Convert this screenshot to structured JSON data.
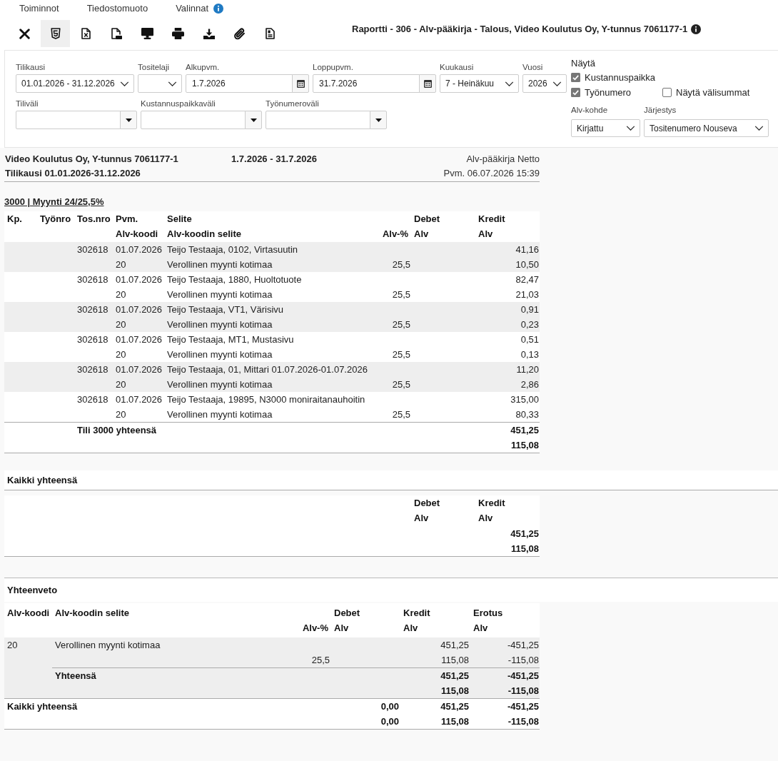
{
  "menu": [
    {
      "label": "Toiminnot",
      "info": false
    },
    {
      "label": "Tiedostomuoto",
      "info": false
    },
    {
      "label": "Valinnat",
      "info": true
    }
  ],
  "toolbar": [
    {
      "kind": "close",
      "selected": false
    },
    {
      "kind": "html",
      "selected": true
    },
    {
      "kind": "excel",
      "selected": false
    },
    {
      "kind": "pdf",
      "selected": false
    },
    {
      "kind": "screen",
      "selected": false
    },
    {
      "kind": "print",
      "selected": false
    },
    {
      "kind": "download",
      "selected": false
    },
    {
      "kind": "attachment",
      "selected": false
    },
    {
      "kind": "document",
      "selected": false
    }
  ],
  "report_title": "Raportti - 306 - Alv-pääkirja - Talous, Video Koulutus Oy, Y-tunnus 7061177-1",
  "filters": {
    "lines": [
      {
        "fields": [
          {
            "kind": "select",
            "label": "Tilikausi",
            "value": "01.01.2026 - 31.12.2026"
          },
          {
            "kind": "select",
            "label": "Tositelaji"
          },
          {
            "kind": "date",
            "label": "Alkupvm.",
            "value": "1.7.2026"
          },
          {
            "kind": "date",
            "label": "Loppupvm.",
            "value": "31.7.2026"
          },
          {
            "kind": "select",
            "label": "Kuukausi",
            "value": "7 - Heinäkuu"
          },
          {
            "kind": "select",
            "label": "Vuosi",
            "value": "2026"
          }
        ]
      },
      {
        "fields": [
          {
            "kind": "combo",
            "label": "Tiliväli"
          },
          {
            "kind": "combo",
            "label": "Kustannuspaikkaväli"
          },
          {
            "kind": "combo",
            "label": "Työnumeroväli"
          }
        ]
      }
    ],
    "show": {
      "label": "Näytä",
      "lines": [
        {
          "options": [
            {
              "label": "Kustannuspaikka",
              "checked": true
            }
          ]
        },
        {
          "options": [
            {
              "label": "Työnumero",
              "checked": true
            },
            {
              "label": "Näytä välisummat",
              "checked": false
            }
          ]
        }
      ]
    },
    "selects": [
      {
        "label": "Alv-kohde",
        "value": "Kirjattu"
      },
      {
        "label": "Järjestys",
        "value": "Tositenumero Nouseva"
      }
    ]
  },
  "report": {
    "company": "Video Koulutus Oy, Y-tunnus 7061177-1",
    "period": "1.7.2026 - 31.7.2026",
    "name": "Alv-pääkirja Netto",
    "fiscal_period": "Tilikausi 01.01.2026-31.12.2026",
    "printed": "Pvm. 06.07.2026 15:39",
    "account": {
      "heading": "3000 | Myynti 24/25,5%",
      "columns": [
        {
          "line_1": "Kp."
        },
        {
          "line_1": "Työnro"
        },
        {
          "line_1": "Tos.nro"
        },
        {
          "line_1": "Pvm.",
          "line_2": "Alv-koodi"
        },
        {
          "line_1": "Selite",
          "line_2": "Alv-koodin selite"
        },
        {
          "line_2": "Alv-%"
        },
        {
          "line_1": "Debet",
          "line_2": "Alv"
        },
        {
          "line_1": "Kredit",
          "line_2": "Alv"
        }
      ],
      "entries": [
        {
          "voucher": "302618",
          "date": "01.07.2026",
          "description": "Teijo Testaaja, 0102, Virtasuutin",
          "credit": "41,16",
          "vat_code": "20",
          "vat_code_text": "Verollinen myynti kotimaa",
          "vat_percent": "25,5",
          "vat_credit": "10,50"
        },
        {
          "voucher": "302618",
          "date": "01.07.2026",
          "description": "Teijo Testaaja, 1880, Huoltotuote",
          "credit": "82,47",
          "vat_code": "20",
          "vat_code_text": "Verollinen myynti kotimaa",
          "vat_percent": "25,5",
          "vat_credit": "21,03"
        },
        {
          "voucher": "302618",
          "date": "01.07.2026",
          "description": "Teijo Testaaja, VT1, Värisivu",
          "credit": "0,91",
          "vat_code": "20",
          "vat_code_text": "Verollinen myynti kotimaa",
          "vat_percent": "25,5",
          "vat_credit": "0,23"
        },
        {
          "voucher": "302618",
          "date": "01.07.2026",
          "description": "Teijo Testaaja, MT1, Mustasivu",
          "credit": "0,51",
          "vat_code": "20",
          "vat_code_text": "Verollinen myynti kotimaa",
          "vat_percent": "25,5",
          "vat_credit": "0,13"
        },
        {
          "voucher": "302618",
          "date": "01.07.2026",
          "description": "Teijo Testaaja, 01, Mittari 01.07.2026-01.07.2026",
          "credit": "11,20",
          "vat_code": "20",
          "vat_code_text": "Verollinen myynti kotimaa",
          "vat_percent": "25,5",
          "vat_credit": "2,86"
        },
        {
          "voucher": "302618",
          "date": "01.07.2026",
          "description": "Teijo Testaaja, 19895, N3000 moniraitanauhoitin",
          "credit": "315,00",
          "vat_code": "20",
          "vat_code_text": "Verollinen myynti kotimaa",
          "vat_percent": "25,5",
          "vat_credit": "80,33"
        }
      ],
      "total": {
        "label": "Tili 3000 yhteensä",
        "credit": "451,25",
        "vat_credit": "115,08"
      }
    }
  },
  "grand_total": {
    "title": "Kaikki yhteensä",
    "columns": [
      {
        "line_1": "Debet",
        "line_2": "Alv"
      },
      {
        "line_1": "Kredit",
        "line_2": "Alv"
      }
    ],
    "credit": "451,25",
    "vat_credit": "115,08"
  },
  "summary": {
    "title": "Yhteenveto",
    "columns": [
      {
        "line_1": "Alv-koodi"
      },
      {
        "line_1": "Alv-koodin selite"
      },
      {
        "line_2": "Alv-%"
      },
      {
        "line_1": "Debet",
        "line_2": "Alv"
      },
      {
        "line_1": "Kredit",
        "line_2": "Alv"
      },
      {
        "line_1": "Erotus",
        "line_2": "Alv"
      }
    ],
    "rows": [
      {
        "vat_code": "20",
        "vat_code_text": "Verollinen myynti kotimaa",
        "credit": "451,25",
        "difference": "-451,25",
        "vat_percent": "25,5",
        "vat_credit": "115,08",
        "vat_difference": "-115,08"
      }
    ],
    "subtotal": {
      "label": "Yhteensä",
      "credit": "451,25",
      "difference": "-451,25",
      "vat_credit": "115,08",
      "vat_difference": "-115,08"
    },
    "total": {
      "label": "Kaikki yhteensä",
      "debit": "0,00",
      "credit": "451,25",
      "difference": "-451,25",
      "vat_debit": "0,00",
      "vat_credit": "115,08",
      "vat_difference": "-115,08"
    }
  }
}
